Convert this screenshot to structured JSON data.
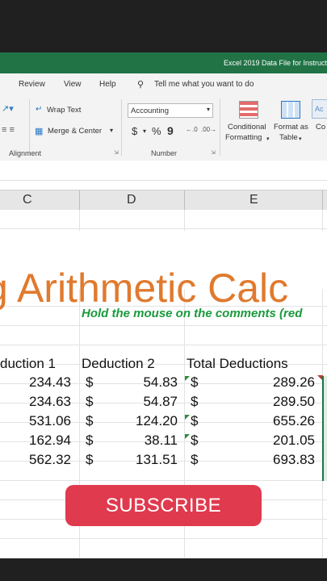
{
  "titlebar": {
    "title": "Excel 2019 Data File for Instruct"
  },
  "menu": {
    "review": "Review",
    "view": "View",
    "help": "Help",
    "tell_me": "Tell me what you want to do"
  },
  "ribbon": {
    "wrap_text": "Wrap Text",
    "merge_center": "Merge & Center",
    "number_format": "Accounting",
    "currency_symbol": "$",
    "percent_symbol": "%",
    "comma_symbol": "9",
    "conditional_formatting_line1": "Conditional",
    "conditional_formatting_line2": "Formatting",
    "format_as_table_line1": "Format as",
    "format_as_table_line2": "Table",
    "cell_styles_partial": "Co",
    "ac_partial": "Ac",
    "group_alignment": "Alignment",
    "group_number": "Number"
  },
  "columns": [
    "C",
    "D",
    "E"
  ],
  "sheet": {
    "title_text": "g Arithmetic Calc",
    "note": "Hold the mouse on the comments (red",
    "headers": {
      "c": "duction 1",
      "d": "Deduction 2",
      "e": "Total Deductions"
    },
    "rows": [
      {
        "c": "234.43",
        "d": "54.83",
        "e": "289.26"
      },
      {
        "c": "234.63",
        "d": "54.87",
        "e": "289.50"
      },
      {
        "c": "531.06",
        "d": "124.20",
        "e": "655.26"
      },
      {
        "c": "162.94",
        "d": "38.11",
        "e": "201.05"
      },
      {
        "c": "562.32",
        "d": "131.51",
        "e": "693.83"
      }
    ],
    "dollar": "$"
  },
  "overlay": {
    "subscribe": "SUBSCRIBE",
    "subscribe_color": "#e03a4e"
  },
  "colors": {
    "excel_green": "#217346",
    "title_orange": "#e07a2e",
    "note_green": "#1a9a3c"
  }
}
